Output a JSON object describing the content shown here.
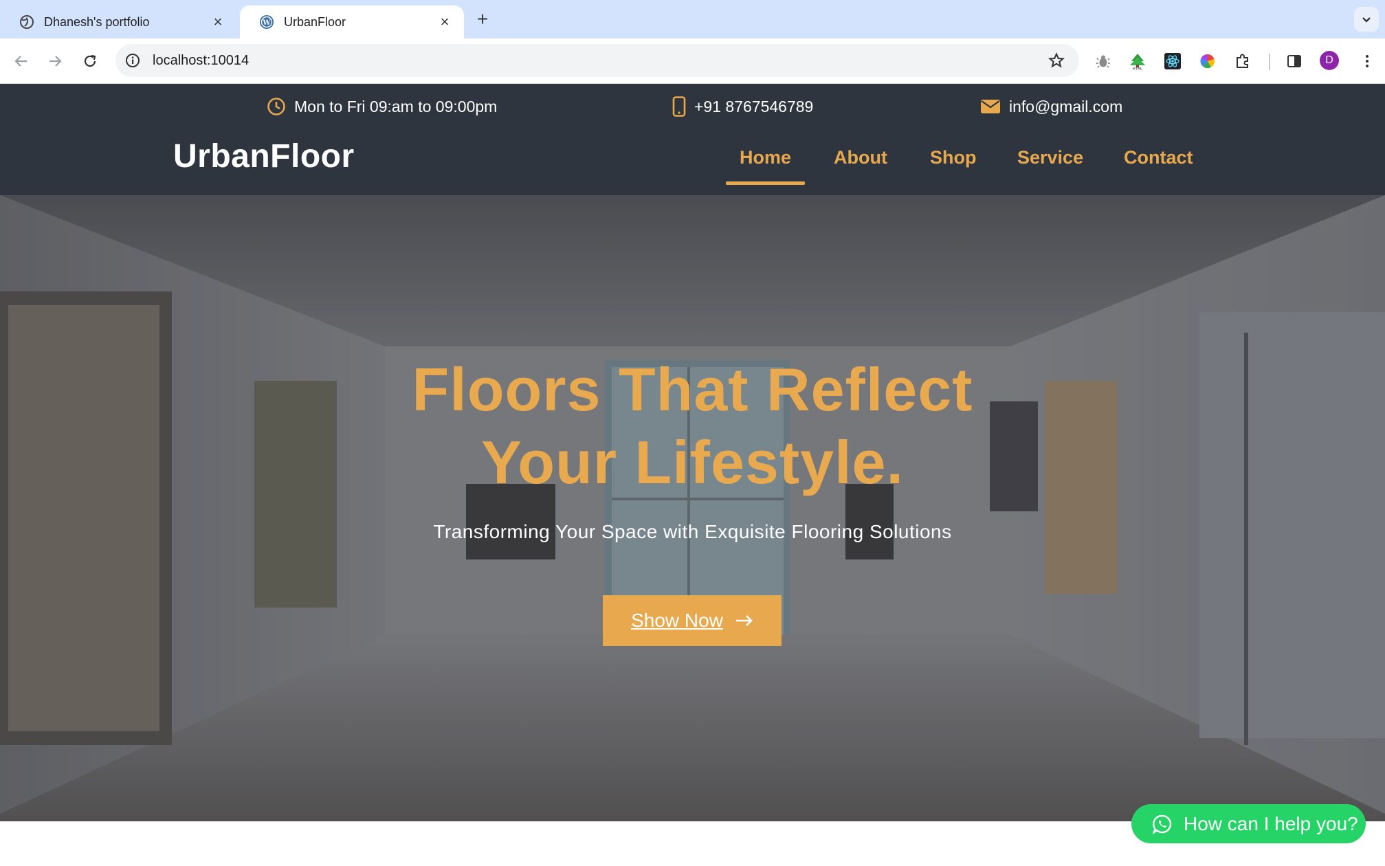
{
  "browser": {
    "tabs": [
      {
        "title": "Dhanesh's portfolio",
        "active": false
      },
      {
        "title": "UrbanFloor",
        "active": true
      }
    ],
    "url": "localhost:10014",
    "profile_initial": "D"
  },
  "site": {
    "topbar": {
      "hours": "Mon to Fri 09:am to 09:00pm",
      "phone": "+91 8767546789",
      "email": "info@gmail.com"
    },
    "logo": "UrbanFloor",
    "nav": [
      {
        "label": "Home",
        "active": true
      },
      {
        "label": "About"
      },
      {
        "label": "Shop"
      },
      {
        "label": "Service"
      },
      {
        "label": "Contact"
      }
    ],
    "hero": {
      "title_line1": "Floors That Reflect",
      "title_line2": "Your Lifestyle.",
      "subtitle": "Transforming Your Space with Exquisite Flooring Solutions",
      "cta_label": "Show Now"
    },
    "chat_label": "How can I help you?"
  },
  "colors": {
    "accent": "#e8a94e",
    "header_bg": "#2e353e",
    "chat_green": "#25d366"
  }
}
